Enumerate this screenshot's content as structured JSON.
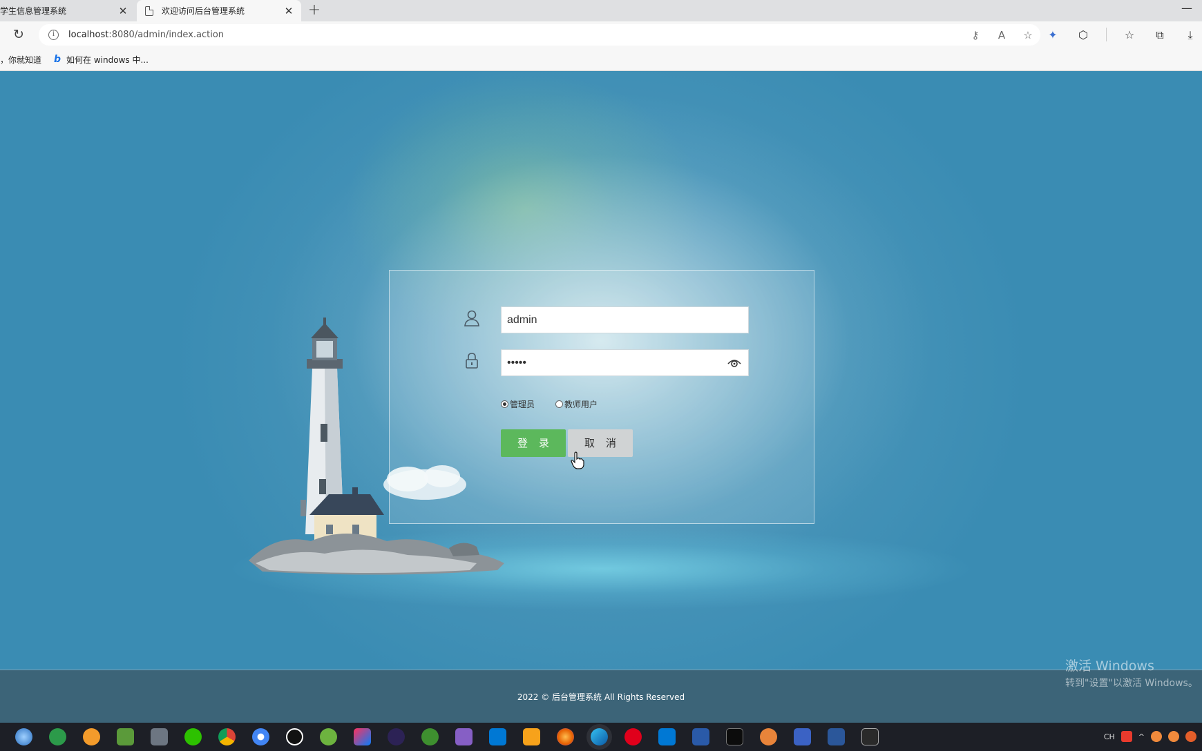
{
  "browser": {
    "tabs": [
      {
        "title": "学生信息管理系统",
        "active": false
      },
      {
        "title": "欢迎访问后台管理系统",
        "active": true
      }
    ],
    "close_glyph": "✕",
    "new_tab_glyph": "+",
    "minimize_glyph": "—",
    "url_host": "localhost",
    "url_rest": ":8080/admin/index.action",
    "favorites": [
      {
        "label": "，你就知道",
        "icon": null
      },
      {
        "label": "如何在 windows 中...",
        "icon": "bing-icon"
      }
    ],
    "bing_glyph": "b"
  },
  "login": {
    "username_value": "admin",
    "password_value": "•••••",
    "roles": [
      {
        "label": "管理员",
        "checked": true
      },
      {
        "label": "教师用户",
        "checked": false
      }
    ],
    "login_label": "登录",
    "cancel_label": "取消"
  },
  "footer": {
    "copyright": "2022 © 后台管理系统 All Rights Reserved"
  },
  "watermark": {
    "line1": "激活 Windows",
    "line2": "转到\"设置\"以激活 Windows。"
  },
  "tray": {
    "lang": "CH"
  },
  "colors": {
    "login_button": "#5cb85c",
    "cancel_button": "#d0d3d4",
    "footer_bg": "#3c6478",
    "page_bg": "#3a8cb3"
  }
}
